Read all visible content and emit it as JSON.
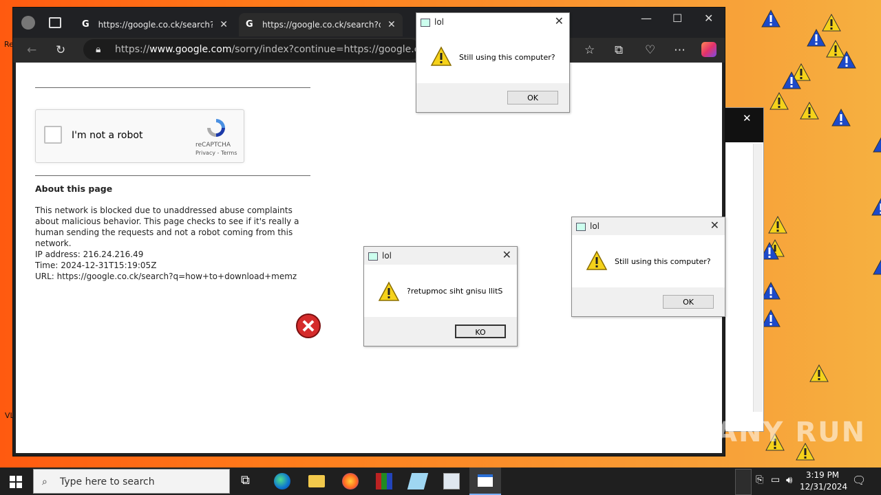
{
  "browser": {
    "tabs": [
      {
        "title": "https://google.co.ck/search?q=d"
      },
      {
        "title": "https://google.co.ck/search?q=h"
      }
    ],
    "url_prefix": "https://",
    "url_host": "www.google.com",
    "url_rest": "/sorry/index?continue=https://google.co.ck/sea"
  },
  "page": {
    "captcha_label": "I'm not a robot",
    "captcha_brand": "reCAPTCHA",
    "captcha_links": "Privacy - Terms",
    "about_heading": "About this page",
    "about_text": "This network is blocked due to unaddressed abuse complaints about malicious behavior. This page checks to see if it's really a human sending the requests and not a robot coming from this network.",
    "ip": "IP address: 216.24.216.49",
    "time": "Time: 2024-12-31T15:19:05Z",
    "url": "URL: https://google.co.ck/search?q=how+to+download+memz"
  },
  "dialogs": [
    {
      "title": "lol",
      "message": "Still using this computer?",
      "button": "OK"
    },
    {
      "title": "lol",
      "message": "?retupmoc siht gnisu llitS",
      "button": "KO"
    },
    {
      "title": "lol",
      "message": "Still using this computer?",
      "button": "OK"
    }
  ],
  "desktop": {
    "labels": [
      "Re",
      "VL"
    ]
  },
  "taskbar": {
    "search_placeholder": "Type here to search",
    "time": "3:19 PM",
    "date": "12/31/2024"
  },
  "watermark": "ANY RUN",
  "colors": {
    "warning_yellow": "#f5d21a",
    "warning_blue": "#1c49c9",
    "desktop_orange": "#ff7a1a"
  }
}
